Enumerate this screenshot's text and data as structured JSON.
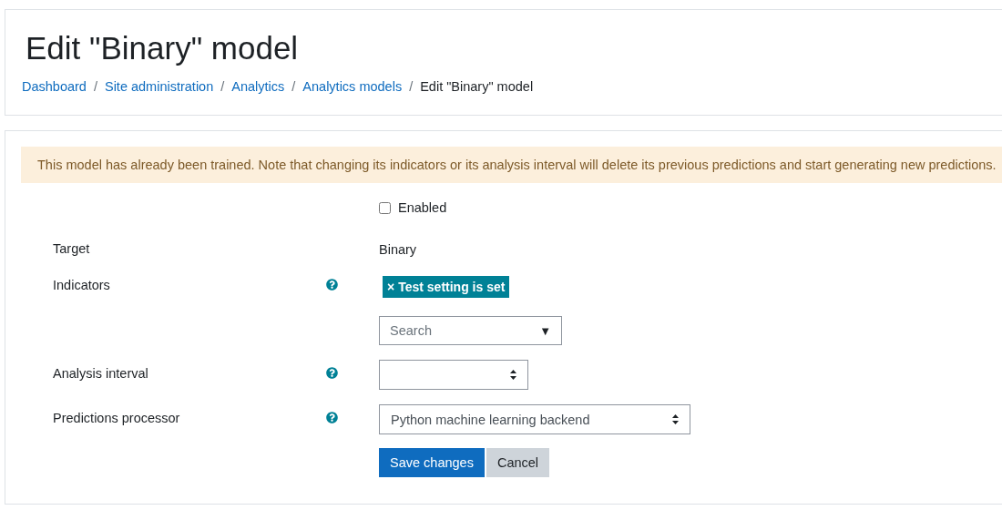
{
  "page_title": "Edit \"Binary\" model",
  "breadcrumb_separator": "/",
  "breadcrumbs": [
    {
      "label": "Dashboard",
      "kind": "link"
    },
    {
      "label": "Site administration",
      "kind": "link"
    },
    {
      "label": "Analytics",
      "kind": "link"
    },
    {
      "label": "Analytics models",
      "kind": "link"
    },
    {
      "label": "Edit \"Binary\" model",
      "kind": "current"
    }
  ],
  "alert": "This model has already been trained. Note that changing its indicators or its analysis interval will delete its previous predictions and start generating new predictions.",
  "fields": [
    {
      "kind": "checkbox",
      "label": "Enabled",
      "checked": false
    },
    {
      "kind": "static",
      "label": "Target",
      "value": "Binary"
    },
    {
      "kind": "autocomplete",
      "label": "Indicators",
      "help": true,
      "tags": [
        {
          "remove": "×",
          "label": "Test setting is set"
        }
      ],
      "placeholder": "Search",
      "toggle": "▼"
    },
    {
      "kind": "select",
      "label": "Analysis interval",
      "help": true
    },
    {
      "kind": "select",
      "label": "Predictions processor",
      "help": true,
      "value": "Python machine learning backend"
    }
  ],
  "buttons": [
    {
      "label": "Save changes",
      "kind": "primary"
    },
    {
      "label": "Cancel",
      "kind": "secondary"
    }
  ]
}
